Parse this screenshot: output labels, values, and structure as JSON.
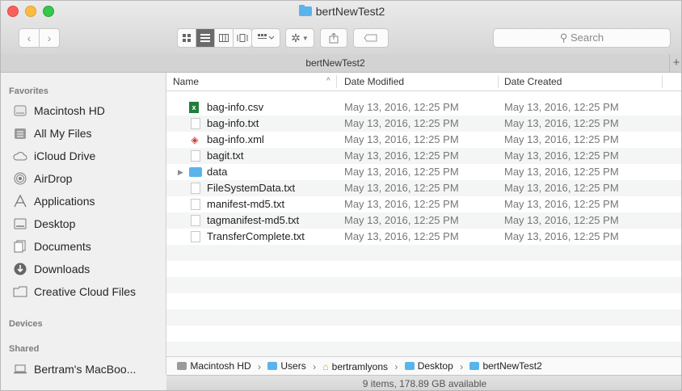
{
  "window": {
    "title": "bertNewTest2"
  },
  "toolbar": {
    "back_glyph": "‹",
    "forward_glyph": "›",
    "view_modes": [
      "icon-view",
      "list-view",
      "column-view",
      "coverflow-view"
    ],
    "search_placeholder": "Search"
  },
  "tab": {
    "title": "bertNewTest2",
    "add_glyph": "+"
  },
  "sidebar": {
    "favorites_label": "Favorites",
    "favorites": [
      {
        "label": "Macintosh HD",
        "icon": "harddisk-icon"
      },
      {
        "label": "All My Files",
        "icon": "all-files-icon"
      },
      {
        "label": "iCloud Drive",
        "icon": "cloud-icon"
      },
      {
        "label": "AirDrop",
        "icon": "airdrop-icon"
      },
      {
        "label": "Applications",
        "icon": "applications-icon"
      },
      {
        "label": "Desktop",
        "icon": "desktop-icon"
      },
      {
        "label": "Documents",
        "icon": "documents-icon"
      },
      {
        "label": "Downloads",
        "icon": "downloads-icon"
      },
      {
        "label": "Creative Cloud Files",
        "icon": "folder-icon"
      }
    ],
    "devices_label": "Devices",
    "shared_label": "Shared",
    "shared": [
      {
        "label": "Bertram's MacBoo...",
        "icon": "laptop-icon"
      }
    ]
  },
  "columns": {
    "name": "Name",
    "sort_glyph": "^",
    "modified": "Date Modified",
    "created": "Date Created"
  },
  "files": [
    {
      "name": "bag-info.csv",
      "kind": "csv",
      "modified": "May 13, 2016, 12:25 PM",
      "created": "May 13, 2016, 12:25 PM"
    },
    {
      "name": "bag-info.txt",
      "kind": "txt",
      "modified": "May 13, 2016, 12:25 PM",
      "created": "May 13, 2016, 12:25 PM"
    },
    {
      "name": "bag-info.xml",
      "kind": "xml",
      "modified": "May 13, 2016, 12:25 PM",
      "created": "May 13, 2016, 12:25 PM"
    },
    {
      "name": "bagit.txt",
      "kind": "txt",
      "modified": "May 13, 2016, 12:25 PM",
      "created": "May 13, 2016, 12:25 PM"
    },
    {
      "name": "data",
      "kind": "folder",
      "modified": "May 13, 2016, 12:25 PM",
      "created": "May 13, 2016, 12:25 PM"
    },
    {
      "name": "FileSystemData.txt",
      "kind": "txt",
      "modified": "May 13, 2016, 12:25 PM",
      "created": "May 13, 2016, 12:25 PM"
    },
    {
      "name": "manifest-md5.txt",
      "kind": "txt",
      "modified": "May 13, 2016, 12:25 PM",
      "created": "May 13, 2016, 12:25 PM"
    },
    {
      "name": "tagmanifest-md5.txt",
      "kind": "txt",
      "modified": "May 13, 2016, 12:25 PM",
      "created": "May 13, 2016, 12:25 PM"
    },
    {
      "name": "TransferComplete.txt",
      "kind": "txt",
      "modified": "May 13, 2016, 12:25 PM",
      "created": "May 13, 2016, 12:25 PM"
    }
  ],
  "pathbar": [
    "Macintosh HD",
    "Users",
    "bertramlyons",
    "Desktop",
    "bertNewTest2"
  ],
  "status": {
    "text": "9 items, 178.89 GB available"
  },
  "colors": {
    "folder": "#5ab4ec",
    "selected_view": "#6b6b6b",
    "row_alt": "#f4f5f5"
  }
}
